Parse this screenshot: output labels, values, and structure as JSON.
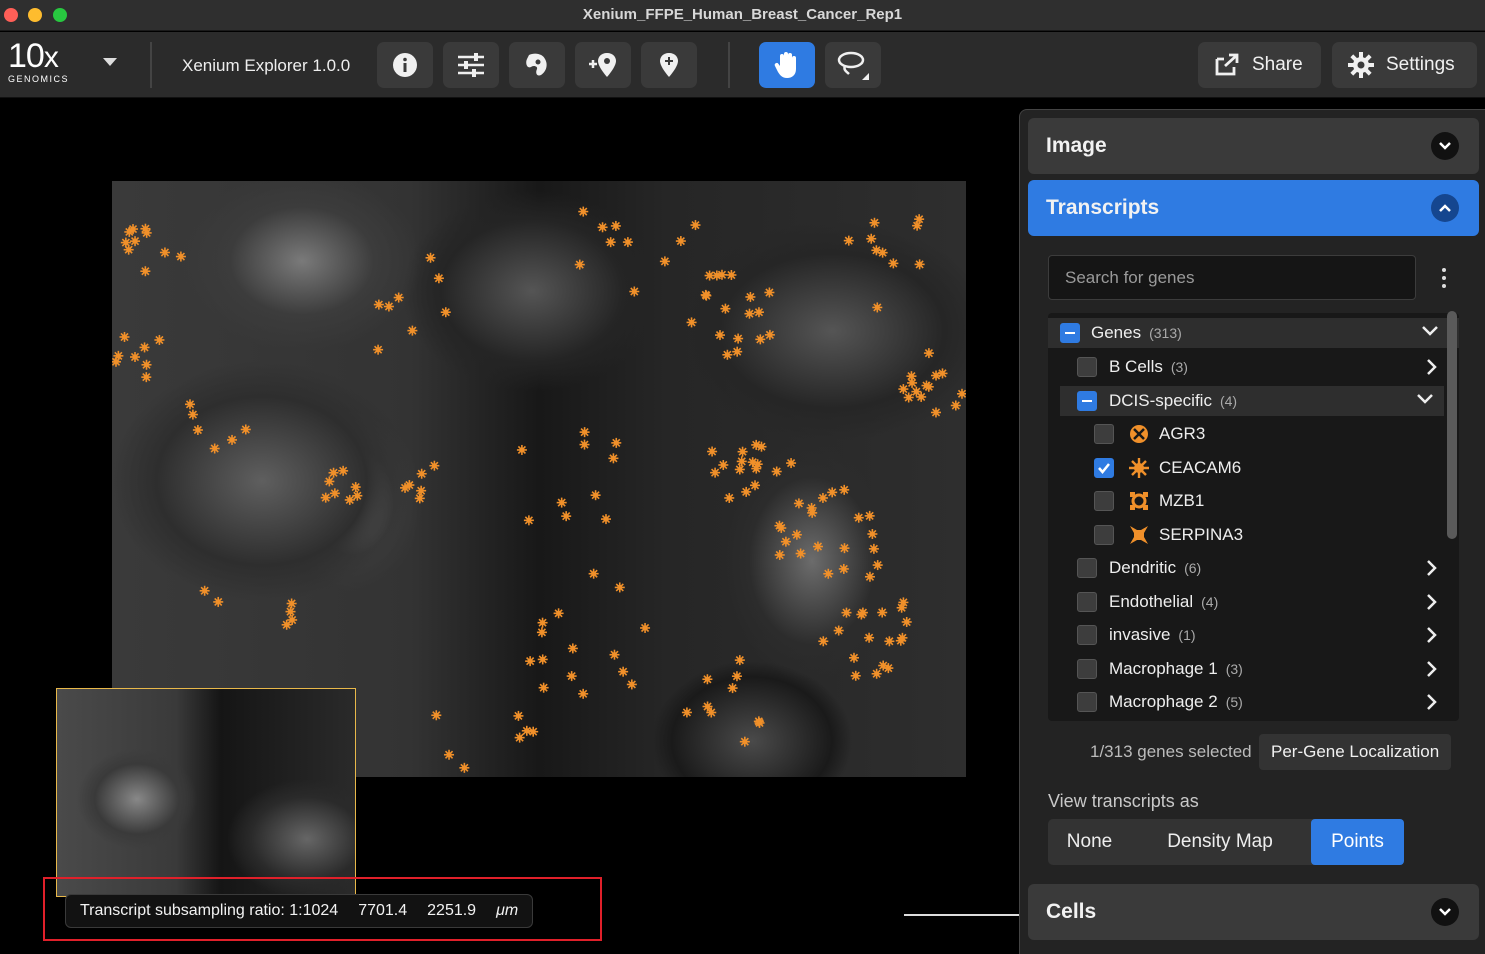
{
  "window": {
    "title": "Xenium_FFPE_Human_Breast_Cancer_Rep1"
  },
  "toolbar": {
    "logo_main": "10",
    "logo_x": "x",
    "logo_sub": "GENOMICS",
    "app_version": "Xenium Explorer 1.0.0",
    "share_label": "Share",
    "settings_label": "Settings",
    "icons": [
      "info-icon",
      "sliders-icon",
      "cell-shape-icon",
      "add-location-icon",
      "map-pin-icon",
      "hand-pan-icon",
      "lasso-icon"
    ],
    "active_tool": "hand-pan-icon"
  },
  "viewer": {
    "status": {
      "ratio": "Transcript subsampling ratio: 1:1024",
      "x": "7701.4",
      "y": "2251.9",
      "unit": "μm"
    }
  },
  "panel": {
    "image_label": "Image",
    "transcripts_label": "Transcripts",
    "cells_label": "Cells",
    "search_placeholder": "Search for genes",
    "tree": {
      "root": {
        "label": "Genes",
        "count": "(313)"
      },
      "groups": [
        {
          "label": "B Cells",
          "count": "(3)"
        },
        {
          "label": "DCIS-specific",
          "count": "(4)"
        },
        {
          "label": "Dendritic",
          "count": "(6)"
        },
        {
          "label": "Endothelial",
          "count": "(4)"
        },
        {
          "label": "invasive",
          "count": "(1)"
        },
        {
          "label": "Macrophage 1",
          "count": "(3)"
        },
        {
          "label": "Macrophage 2",
          "count": "(5)"
        }
      ],
      "genes": [
        {
          "label": "AGR3",
          "checked": false,
          "icon": "x-circle-marker-icon"
        },
        {
          "label": "CEACAM6",
          "checked": true,
          "icon": "starburst-marker-icon"
        },
        {
          "label": "MZB1",
          "checked": false,
          "icon": "ring-marker-icon"
        },
        {
          "label": "SERPINA3",
          "checked": false,
          "icon": "cross-marker-icon"
        }
      ]
    },
    "selected_count": "1/313 genes selected",
    "per_gene_button": "Per-Gene Localization",
    "view_as_label": "View transcripts as",
    "view_options": [
      "None",
      "Density Map",
      "Points"
    ],
    "view_selected": "Points"
  },
  "colors": {
    "accent": "#2f7be2",
    "marker": "#f0902a",
    "highlight_frame": "#e0202a",
    "minimap_border": "#e8b84a"
  }
}
